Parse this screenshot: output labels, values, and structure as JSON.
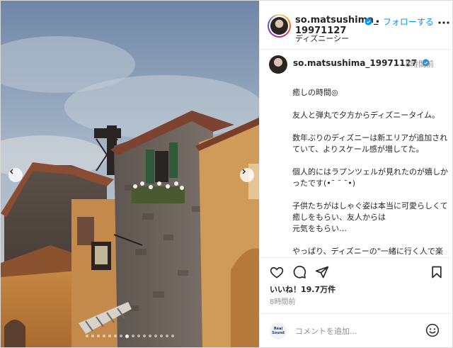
{
  "header": {
    "username_line1": "so.matsushima_",
    "username_line2": "19971127",
    "follow_label": "フォローする",
    "separator": "•",
    "location": "ディズニーシー",
    "more_icon": "more-dots-icon"
  },
  "caption": {
    "username": "so.matsushima_19971127",
    "time": "8時間前",
    "paragraphs": [
      "癒しの時間◎",
      "友人と弾丸で夕方からディズニータイム。",
      "数年ぶりのディズニーは新エリアが追加されていて、よりスケール感が増してた。",
      "個人的にはラプンツェルが見れたのが嬉しかったです(•¯ ˘ ¯•)",
      "子供たちがはしゃぐ姿は本当に可愛らしくて癒しをもらい、友人からは\n元気をもらい…",
      "やっぱり、ディズニーの\"一緒に行く人で楽しさが決まる\"って\n本当だ。"
    ]
  },
  "actions": {
    "like_icon": "heart-icon",
    "comment_icon": "comment-icon",
    "share_icon": "send-icon",
    "save_icon": "bookmark-icon"
  },
  "likes": "いいね！19.7万件",
  "post_time": "8時間前",
  "comment": {
    "logo_text_1": "Real",
    "logo_text_2": "Sound",
    "placeholder": "コメントを追加...",
    "emoji_icon": "smiley-icon"
  },
  "carousel": {
    "total": 16,
    "active_index": 7
  },
  "colors": {
    "accent": "#0095f6",
    "verified": "#0095f6",
    "muted": "#8e8e8e"
  }
}
